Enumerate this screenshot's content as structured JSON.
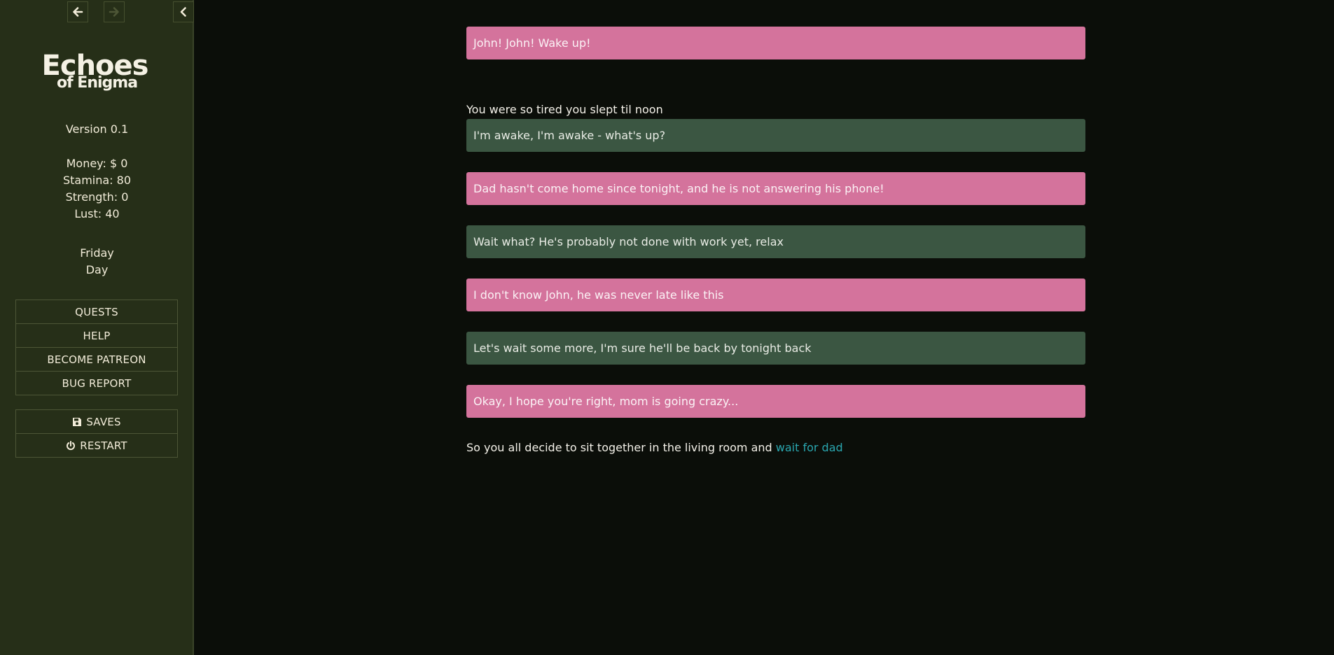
{
  "sidebar": {
    "nav": {
      "back_icon": "arrow-left-icon",
      "forward_icon": "arrow-right-icon",
      "collapse_icon": "chevron-left-icon"
    },
    "logo": {
      "line1": "Echoes",
      "line2": "of Enigma"
    },
    "version": "Version 0.1",
    "stats": {
      "money": "Money: $ 0",
      "stamina": "Stamina: 80",
      "strength": "Strength: 0",
      "lust": "Lust: 40"
    },
    "time": {
      "day": "Friday",
      "period": "Day"
    },
    "menu": [
      {
        "label": "QUESTS"
      },
      {
        "label": "HELP"
      },
      {
        "label": "BECOME PATREON"
      },
      {
        "label": "BUG REPORT"
      }
    ],
    "system_menu": [
      {
        "label": "SAVES",
        "icon": "floppy-disk-icon"
      },
      {
        "label": "RESTART",
        "icon": "power-icon"
      }
    ]
  },
  "story": {
    "line1": "John! John! Wake up!",
    "narration1": "You were so tired you slept til noon",
    "line2": "I'm awake, I'm awake - what's up?",
    "line3": "Dad hasn't come home since tonight, and he is not answering his phone!",
    "line4": "Wait what? He's probably not done with work yet, relax",
    "line5": "I don't know John, he was never late like this",
    "line6": "Let's wait some more, I'm sure he'll be back by tonight back",
    "line7": "Okay, I hope you're right, mom is going crazy...",
    "final_text": "So you all decide to sit together in the living room and ",
    "final_link": "wait for dad"
  },
  "colors": {
    "sidebar_bg": "#262f18",
    "main_bg": "#0b0e09",
    "pink_bubble": "#d4739c",
    "green_bubble": "#3b5642",
    "link": "#2aa7b0"
  }
}
